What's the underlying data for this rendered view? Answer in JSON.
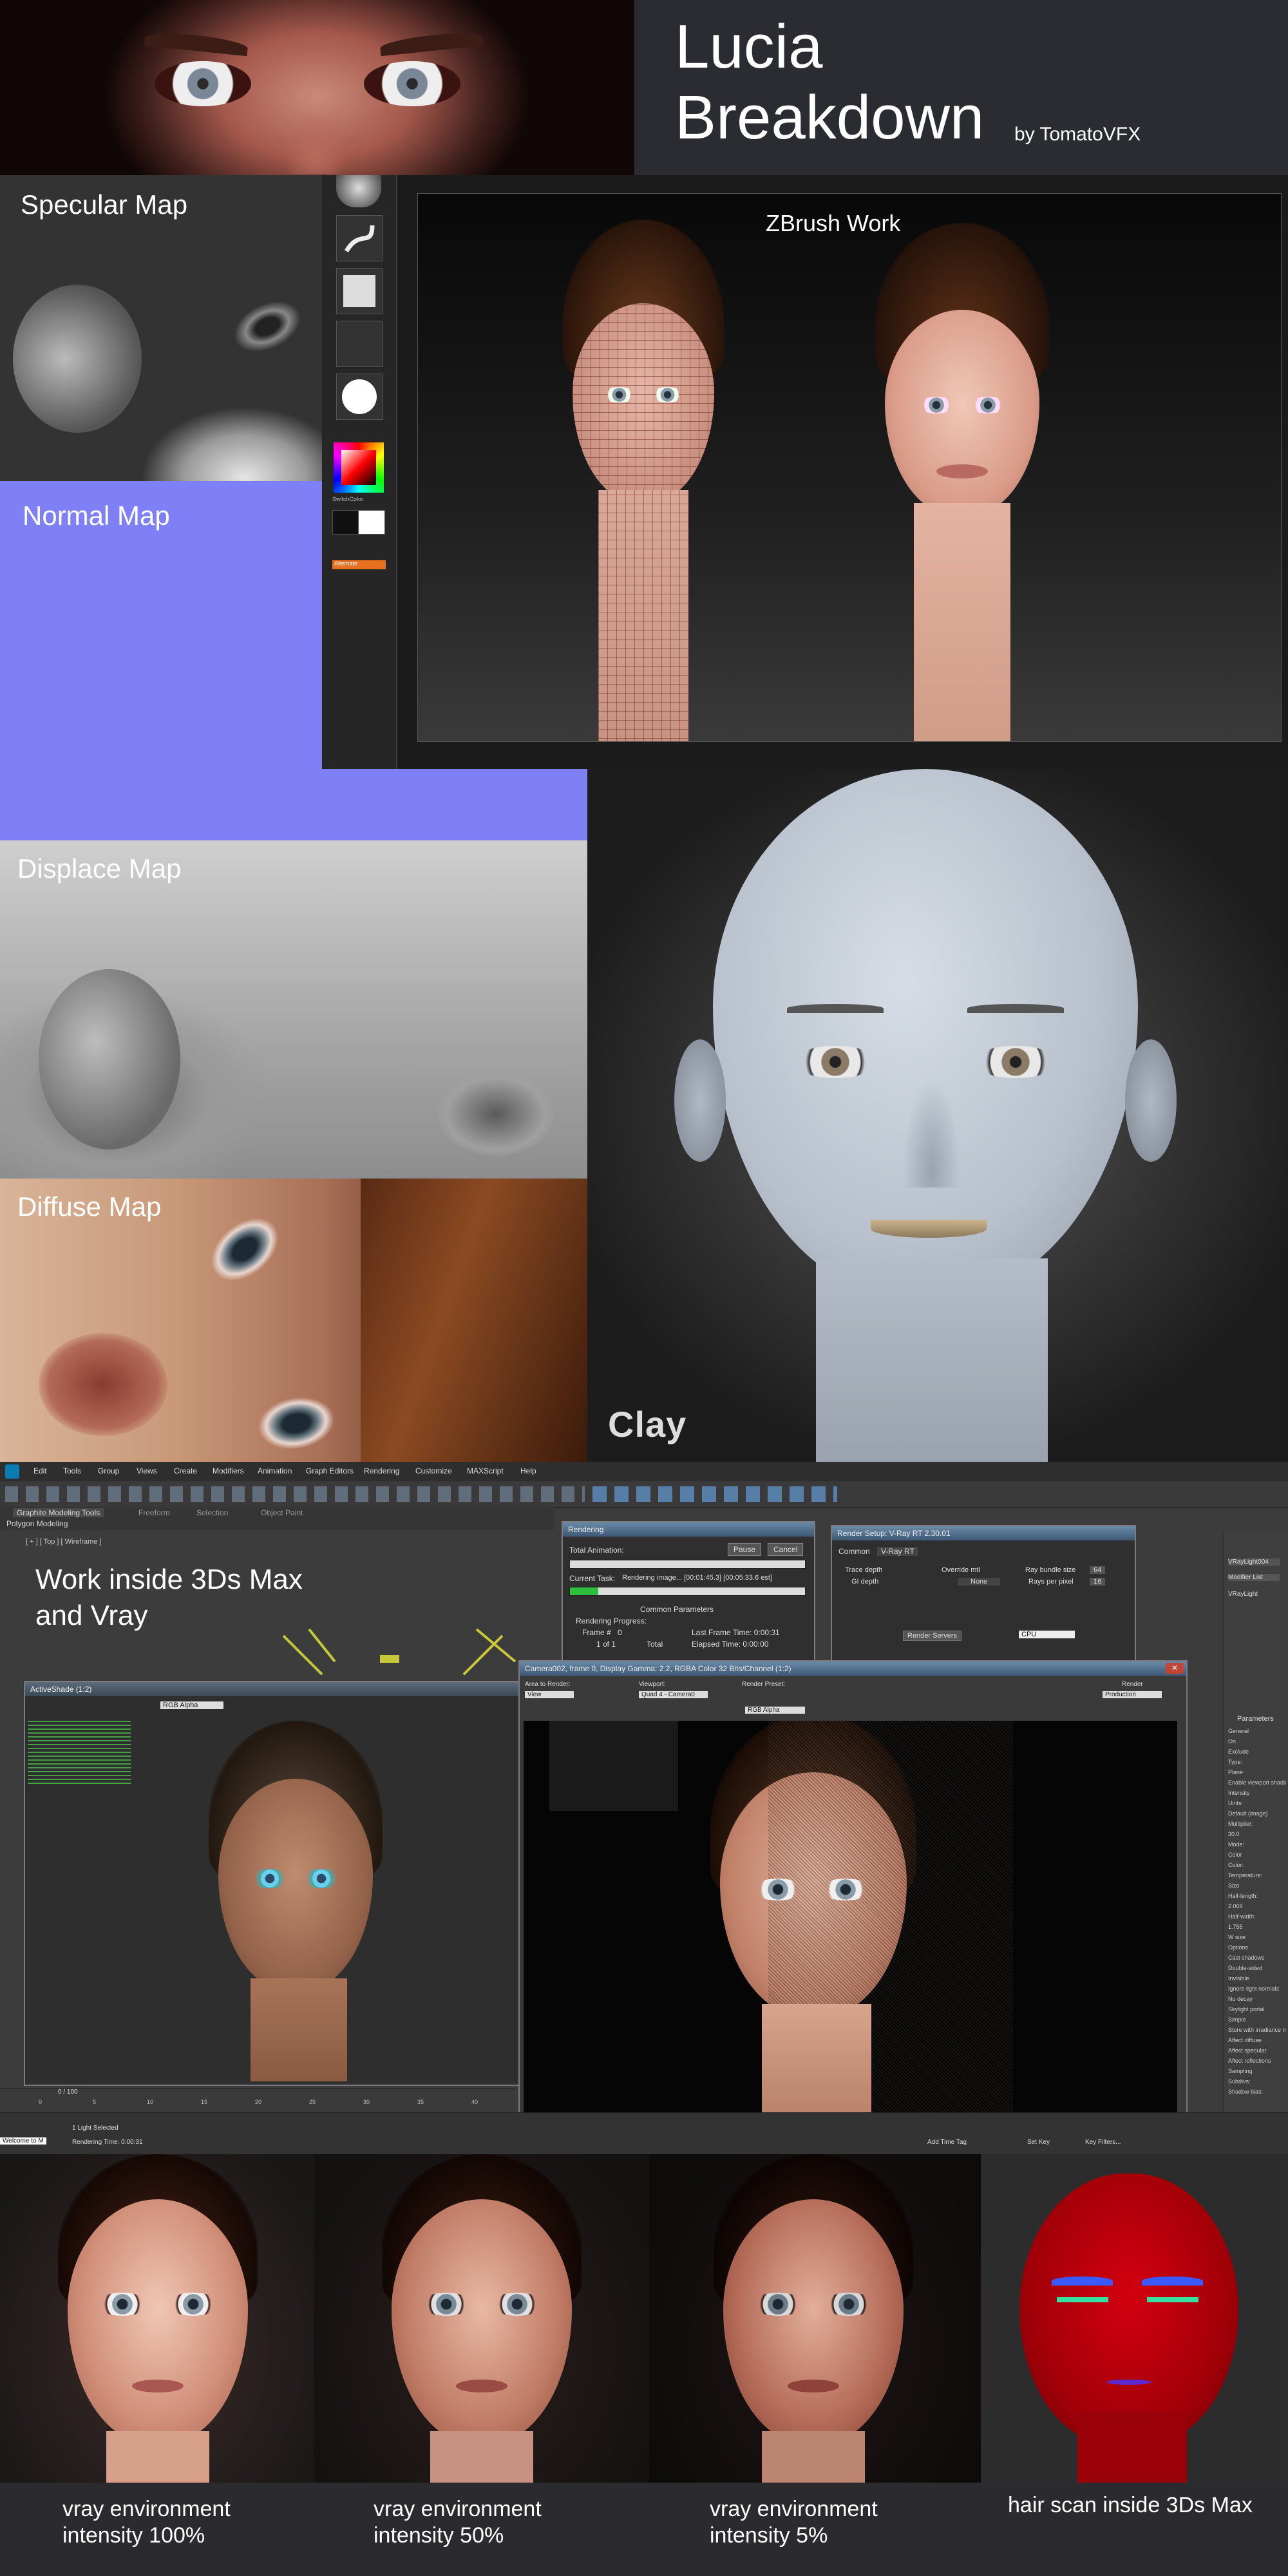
{
  "header": {
    "title_line1": "Lucia",
    "title_line2": "Breakdown",
    "byline": "by TomatoVFX"
  },
  "maps": {
    "specular": "Specular Map",
    "normal": "Normal Map",
    "displace": "Displace Map",
    "diffuse": "Diffuse Map"
  },
  "zbrush": {
    "title": "ZBrush Work",
    "swatch_label1": "SwitchColor",
    "swatch_label2": "Alternate"
  },
  "clay": {
    "label": "Clay"
  },
  "max": {
    "caption_line1": "Work inside 3Ds Max",
    "caption_line2": "and Vray",
    "menu": [
      "Edit",
      "Tools",
      "Group",
      "Views",
      "Create",
      "Modifiers",
      "Animation",
      "Graph Editors",
      "Rendering",
      "Customize",
      "MAXScript",
      "Help"
    ],
    "ribbon_tabs": [
      "Graphite Modeling Tools",
      "Freeform",
      "Selection",
      "Object Paint"
    ],
    "ribbon_sub": "Polygon Modeling",
    "viewport_label": "[ + ] [ Top ] [ Wireframe ]",
    "activeshade_title": "ActiveShade (1:2)",
    "channel_value": "RGB Alpha",
    "rendering_title": "Rendering",
    "rendering_total": "Total Animation:",
    "rendering_current": "Current Task:",
    "rendering_current_value": "Rendering image... [00:01:45.3] [00:05:33.6 est]",
    "pause": "Pause",
    "cancel": "Cancel",
    "common_params": "Common Parameters",
    "render_progress": "Rendering Progress:",
    "frame_label": "Frame #",
    "frame_value": "0",
    "last_frame_time": "Last Frame Time: 0:00:31",
    "elapsed_time": "Elapsed Time: 0:00:00",
    "of_value": "1 of 1",
    "total": "Total",
    "setup_title": "Render Setup: V-Ray RT 2.30.01",
    "setup_tabs": [
      "Common",
      "V-Ray RT"
    ],
    "setup_trace_depth": "Trace depth",
    "setup_gi_depth": "GI depth",
    "setup_override": "Override mtl",
    "setup_none": "None",
    "setup_ray_bundle": "Ray bundle size",
    "setup_ray_bundle_value": "64",
    "setup_rays_pixel": "Rays per pixel",
    "setup_rays_pixel_value": "16",
    "setup_engine_type": "CPU",
    "setup_render_servers": "Render Servers",
    "frame_window_title": "Camera002, frame 0, Display Gamma: 2.2, RGBA Color 32 Bits/Channel (1:2)",
    "area_to_render": "Area to Render:",
    "area_value": "View",
    "viewport": "Viewport:",
    "viewport_value": "Quad 4 - Camera0",
    "render_preset": "Render Preset:",
    "render_btn": "Render",
    "production": "Production",
    "right_panel_name": "VRayLight004",
    "modifier_list": "Modifier List",
    "vraylight": "VRayLight",
    "params_header": "Parameters",
    "params": [
      "General",
      "On",
      "Exclude",
      "Type:",
      "Plane",
      "Enable viewport shading",
      "Intensity",
      "Units:",
      "Default (image)",
      "Multiplier:",
      "30.0",
      "Mode:",
      "Color",
      "Color:",
      "Temperature:",
      "Size",
      "Half-length:",
      "2.069",
      "Half-width:",
      "1.755",
      "W size",
      "Options",
      "Cast shadows",
      "Double-sided",
      "Invisible",
      "Ignore light normals",
      "No decay",
      "Skylight portal",
      "Simple",
      "Store with irradiance map",
      "Affect diffuse",
      "Affect specular",
      "Affect reflections",
      "Sampling",
      "Subdivs:",
      "Shadow bias:"
    ],
    "timeline_label": "0 / 100",
    "ticks": [
      "0",
      "5",
      "10",
      "15",
      "20",
      "25",
      "30",
      "35",
      "40"
    ],
    "status_left": "Welcome to M",
    "status_sel": "1 Light Selected",
    "status_time": "Rendering Time: 0:00:31",
    "add_time_tag": "Add Time Tag",
    "set_key": "Set Key",
    "key_filters": "Key Filters..."
  },
  "bottom": {
    "captions": [
      {
        "line1": "vray environment",
        "line2": "intensity 100%"
      },
      {
        "line1": "vray environment",
        "line2": "intensity 50%"
      },
      {
        "line1": "vray environment",
        "line2": "intensity 5%"
      },
      {
        "line1": "hair scan inside 3Ds Max",
        "line2": ""
      }
    ]
  },
  "colors": {
    "normal_map": "#7f7ff6",
    "hair_scan_red": "#c0000b",
    "title_bg": "#2b2b32"
  }
}
